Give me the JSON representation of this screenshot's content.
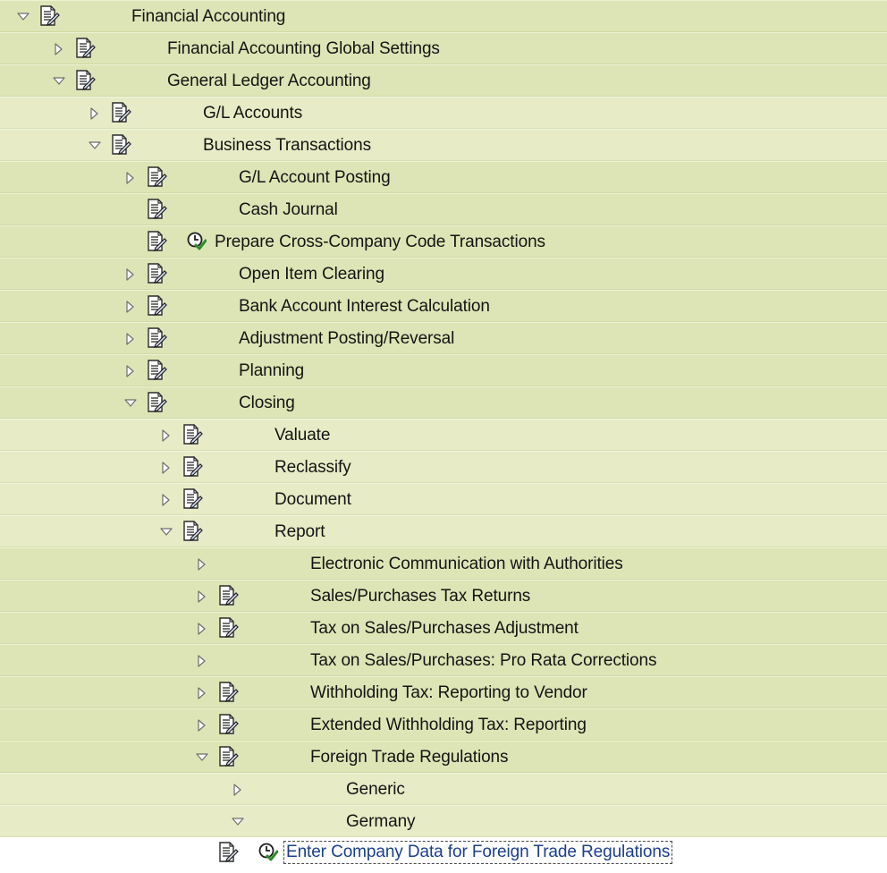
{
  "tree": {
    "nodes": [
      {
        "label": "Financial Accounting",
        "state": "expanded",
        "doc": true,
        "exec": false
      },
      {
        "label": "Financial Accounting Global Settings",
        "state": "collapsed",
        "doc": true,
        "exec": false
      },
      {
        "label": "General Ledger Accounting",
        "state": "expanded",
        "doc": true,
        "exec": false
      },
      {
        "label": "G/L Accounts",
        "state": "collapsed",
        "doc": true,
        "exec": false
      },
      {
        "label": "Business Transactions",
        "state": "expanded",
        "doc": true,
        "exec": false
      },
      {
        "label": "G/L Account Posting",
        "state": "collapsed",
        "doc": true,
        "exec": false
      },
      {
        "label": "Cash Journal",
        "state": "leaf",
        "doc": true,
        "exec": false
      },
      {
        "label": "Prepare Cross-Company Code Transactions",
        "state": "leaf",
        "doc": true,
        "exec": true
      },
      {
        "label": "Open Item Clearing",
        "state": "collapsed",
        "doc": true,
        "exec": false
      },
      {
        "label": "Bank Account Interest Calculation",
        "state": "collapsed",
        "doc": true,
        "exec": false
      },
      {
        "label": "Adjustment Posting/Reversal",
        "state": "collapsed",
        "doc": true,
        "exec": false
      },
      {
        "label": "Planning",
        "state": "collapsed",
        "doc": true,
        "exec": false
      },
      {
        "label": "Closing",
        "state": "expanded",
        "doc": true,
        "exec": false
      },
      {
        "label": "Valuate",
        "state": "collapsed",
        "doc": true,
        "exec": false
      },
      {
        "label": "Reclassify",
        "state": "collapsed",
        "doc": true,
        "exec": false
      },
      {
        "label": "Document",
        "state": "collapsed",
        "doc": true,
        "exec": false
      },
      {
        "label": "Report",
        "state": "expanded",
        "doc": true,
        "exec": false
      },
      {
        "label": "Electronic Communication with Authorities",
        "state": "collapsed",
        "doc": false,
        "exec": false
      },
      {
        "label": "Sales/Purchases Tax Returns",
        "state": "collapsed",
        "doc": true,
        "exec": false
      },
      {
        "label": "Tax on Sales/Purchases Adjustment",
        "state": "collapsed",
        "doc": true,
        "exec": false
      },
      {
        "label": "Tax on Sales/Purchases: Pro Rata Corrections",
        "state": "collapsed",
        "doc": false,
        "exec": false
      },
      {
        "label": "Withholding Tax: Reporting to Vendor",
        "state": "collapsed",
        "doc": true,
        "exec": false
      },
      {
        "label": "Extended Withholding Tax: Reporting",
        "state": "collapsed",
        "doc": true,
        "exec": false
      },
      {
        "label": "Foreign Trade Regulations",
        "state": "expanded",
        "doc": true,
        "exec": false
      },
      {
        "label": "Generic",
        "state": "collapsed",
        "doc": false,
        "exec": false
      },
      {
        "label": "Germany",
        "state": "expanded",
        "doc": false,
        "exec": false
      },
      {
        "label": "Enter Company Data for Foreign Trade Regulations",
        "state": "leaf",
        "doc": true,
        "exec": true,
        "selected": true
      }
    ]
  },
  "colors": {
    "band_dark": "#dde5b6",
    "band_light": "#e7ecc6",
    "selected_text": "#1a3f8a"
  },
  "icons": {
    "expanded": "triangle-down-icon",
    "collapsed": "triangle-right-icon",
    "doc": "documentation-icon",
    "exec": "execute-clock-icon"
  }
}
